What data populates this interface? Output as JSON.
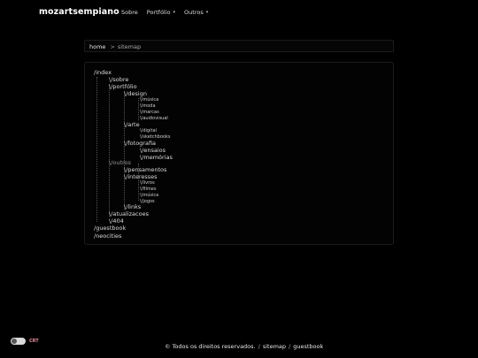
{
  "brand": "mozartsempiano",
  "nav": {
    "sobre": "Sobre",
    "portfolio": "Portfólio",
    "outros": "Outros"
  },
  "breadcrumb": {
    "home": "home",
    "separator": ">",
    "current": "sitemap"
  },
  "tree": {
    "index": "/index",
    "sobre": "\\/sobre",
    "portfolio": "\\/portfólio",
    "design": "\\/design",
    "musica": "\\/música",
    "moda": "\\/moda",
    "marcas": "\\/marcas",
    "audiovisual": "\\/audiovisual",
    "arte": "\\/arte",
    "digital": "\\/digital",
    "sketchbooks": "\\/sketchbooks",
    "fotografia": "\\/fotografia",
    "ensaios": "\\/ensaios",
    "memorias": "\\/memórias",
    "outros": "\\/outros",
    "pensamentos": "\\/pensamentos",
    "interesses": "\\/interesses",
    "livros": "\\/livros",
    "filmes": "\\/filmes",
    "musica2": "\\/música",
    "jogos": "\\/jogos",
    "links": "\\/links",
    "atualizacoes": "\\/atualizacoes",
    "p404": "\\/404",
    "guestbook": "/guestbook",
    "neocities": "/neocities"
  },
  "footer": {
    "crt_label": "CRT",
    "copyright": "© Todos os direitos reservados.",
    "sep1": "/",
    "sitemap": "sitemap",
    "sep2": "/",
    "guestbook": "guestbook"
  },
  "colors": {
    "background": "#000000",
    "crt": "#e08a9a"
  },
  "icons": {
    "dropdown": "chevron-down-icon"
  }
}
